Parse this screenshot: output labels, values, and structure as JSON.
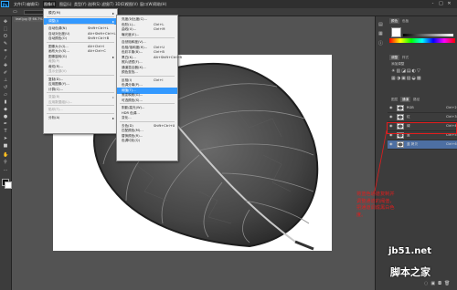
{
  "app": {
    "logo": "Ps",
    "window_controls": [
      "-",
      "□",
      "✕"
    ]
  },
  "menubar": [
    {
      "label": "文件(F)"
    },
    {
      "label": "编辑(E)"
    },
    {
      "label": "图像(I)",
      "active": true
    },
    {
      "label": "图层(L)"
    },
    {
      "label": "类型(Y)"
    },
    {
      "label": "选择(S)"
    },
    {
      "label": "滤镜(T)"
    },
    {
      "label": "3D(D)"
    },
    {
      "label": "视图(V)"
    },
    {
      "label": "窗口(W)"
    },
    {
      "label": "帮助(H)"
    }
  ],
  "document": {
    "tab_label": "leaf.jpg @ 66.7%"
  },
  "image_menu": [
    {
      "label": "模式(M)",
      "shortcut": "",
      "arrow": true
    },
    {
      "sep": true
    },
    {
      "label": "调整(J)",
      "shortcut": "",
      "arrow": true,
      "highlight": true
    },
    {
      "sep": true
    },
    {
      "label": "自动色调(N)",
      "shortcut": "Shift+Ctrl+L"
    },
    {
      "label": "自动对比度(U)",
      "shortcut": "Alt+Shift+Ctrl+L"
    },
    {
      "label": "自动颜色(O)",
      "shortcut": "Shift+Ctrl+B"
    },
    {
      "sep": true
    },
    {
      "label": "图像大小(I)...",
      "shortcut": "Alt+Ctrl+I"
    },
    {
      "label": "画布大小(S)...",
      "shortcut": "Alt+Ctrl+C"
    },
    {
      "label": "图像旋转(G)",
      "shortcut": "",
      "arrow": true
    },
    {
      "label": "裁剪(P)",
      "shortcut": "",
      "disabled": true
    },
    {
      "label": "裁切(R)...",
      "shortcut": ""
    },
    {
      "label": "显示全部(V)",
      "shortcut": "",
      "disabled": true
    },
    {
      "sep": true
    },
    {
      "label": "复制(D)...",
      "shortcut": ""
    },
    {
      "label": "应用图像(Y)...",
      "shortcut": ""
    },
    {
      "label": "计算(C)...",
      "shortcut": ""
    },
    {
      "sep": true
    },
    {
      "label": "变量(B)",
      "shortcut": "",
      "arrow": true,
      "disabled": true
    },
    {
      "label": "应用数据组(L)...",
      "shortcut": "",
      "disabled": true
    },
    {
      "sep": true
    },
    {
      "label": "陷印(T)...",
      "shortcut": "",
      "disabled": true
    },
    {
      "sep": true
    },
    {
      "label": "分析(A)",
      "shortcut": "",
      "arrow": true
    }
  ],
  "adjust_menu": [
    {
      "label": "亮度/对比度(C)...",
      "shortcut": ""
    },
    {
      "label": "色阶(L)...",
      "shortcut": "Ctrl+L"
    },
    {
      "label": "曲线(U)...",
      "shortcut": "Ctrl+M"
    },
    {
      "label": "曝光度(E)...",
      "shortcut": ""
    },
    {
      "sep": true
    },
    {
      "label": "自然饱和度(V)...",
      "shortcut": ""
    },
    {
      "label": "色相/饱和度(H)...",
      "shortcut": "Ctrl+U"
    },
    {
      "label": "色彩平衡(B)...",
      "shortcut": "Ctrl+B"
    },
    {
      "label": "黑白(K)...",
      "shortcut": "Alt+Shift+Ctrl+B"
    },
    {
      "label": "照片滤镜(F)...",
      "shortcut": ""
    },
    {
      "label": "通道混合器(X)...",
      "shortcut": ""
    },
    {
      "label": "颜色查找...",
      "shortcut": ""
    },
    {
      "sep": true
    },
    {
      "label": "反相(I)",
      "shortcut": "Ctrl+I"
    },
    {
      "label": "色调分离(P)...",
      "shortcut": ""
    },
    {
      "label": "阈值(T)...",
      "shortcut": "",
      "highlight": true
    },
    {
      "label": "渐变映射(G)...",
      "shortcut": ""
    },
    {
      "label": "可选颜色(S)...",
      "shortcut": ""
    },
    {
      "sep": true
    },
    {
      "label": "阴影/高光(W)...",
      "shortcut": ""
    },
    {
      "label": "HDR 色调...",
      "shortcut": ""
    },
    {
      "label": "变化...",
      "shortcut": ""
    },
    {
      "sep": true
    },
    {
      "label": "去色(D)",
      "shortcut": "Shift+Ctrl+U"
    },
    {
      "label": "匹配颜色(M)...",
      "shortcut": ""
    },
    {
      "label": "替换颜色(R)...",
      "shortcut": ""
    },
    {
      "label": "色调均化(Q)",
      "shortcut": ""
    }
  ],
  "panels": {
    "top_tabs": [
      "颜色",
      "色板"
    ],
    "mid_tabs": [
      "调整",
      "样式"
    ],
    "mid_label": "添加调整",
    "layer_tabs": [
      "图层",
      "通道",
      "路径"
    ]
  },
  "channels": [
    {
      "name": "RGB",
      "shortcut": "Ctrl+2"
    },
    {
      "name": "红",
      "shortcut": "Ctrl+3"
    },
    {
      "name": "绿",
      "shortcut": "Ctrl+4"
    },
    {
      "name": "蓝",
      "shortcut": "Ctrl+5"
    },
    {
      "name": "蓝 拷贝",
      "shortcut": "Ctrl+6",
      "selected": true
    }
  ],
  "annotation": {
    "text": "将蓝色通道复制并调整通道的阈值，把通道调成黑白色度。",
    "color": "#e21d1d"
  },
  "watermark": {
    "line1": "jb51.net",
    "line2": "脚本之家"
  }
}
